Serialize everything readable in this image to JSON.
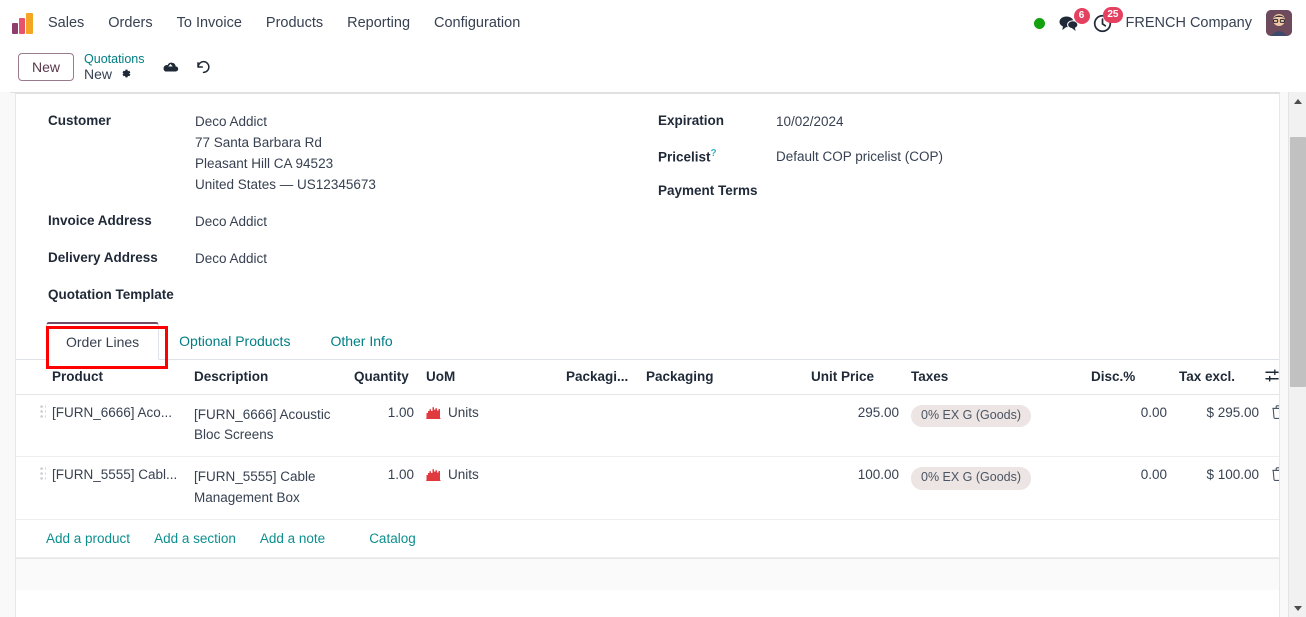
{
  "navbar": {
    "brand_icon": "odoo-sales-logo-icon",
    "menus": [
      {
        "label": "Sales",
        "name": "nav-sales"
      },
      {
        "label": "Orders",
        "name": "nav-orders"
      },
      {
        "label": "To Invoice",
        "name": "nav-to-invoice"
      },
      {
        "label": "Products",
        "name": "nav-products"
      },
      {
        "label": "Reporting",
        "name": "nav-reporting"
      },
      {
        "label": "Configuration",
        "name": "nav-configuration"
      }
    ],
    "status_dot_color": "#13a10e",
    "messages_count": "6",
    "activities_count": "25",
    "company": "FRENCH Company",
    "avatar_glyph": "👤"
  },
  "control_panel": {
    "new_button": "New",
    "breadcrumb_parent": "Quotations",
    "breadcrumb_current": "New",
    "gear_glyph": "⚙",
    "save_glyph": "☁",
    "discard_glyph": "↺"
  },
  "form": {
    "left": [
      {
        "label": "Customer",
        "name": "field-customer",
        "value": "Deco Addict",
        "extra_lines": [
          "77 Santa Barbara Rd",
          "Pleasant Hill CA 94523",
          "United States — US12345673"
        ]
      },
      {
        "label": "Invoice Address",
        "name": "field-invoice-address",
        "value": "Deco Addict",
        "extra_lines": []
      },
      {
        "label": "Delivery Address",
        "name": "field-delivery-address",
        "value": "Deco Addict",
        "extra_lines": []
      },
      {
        "label": "Quotation Template",
        "name": "field-quotation-template",
        "value": "",
        "extra_lines": []
      }
    ],
    "right": [
      {
        "label": "Expiration",
        "name": "field-expiration",
        "value": "10/02/2024",
        "help": false
      },
      {
        "label": "Pricelist",
        "name": "field-pricelist",
        "value": "Default COP pricelist (COP)",
        "help": true
      },
      {
        "label": "Payment Terms",
        "name": "field-payment-terms",
        "value": "",
        "help": false
      }
    ]
  },
  "notebook": {
    "tabs": [
      {
        "label": "Order Lines",
        "name": "tab-order-lines",
        "active": true,
        "highlighted": true
      },
      {
        "label": "Optional Products",
        "name": "tab-optional-products",
        "active": false,
        "highlighted": false
      },
      {
        "label": "Other Info",
        "name": "tab-other-info",
        "active": false,
        "highlighted": false
      }
    ],
    "highlight_color": "#ff0000"
  },
  "order_lines": {
    "headers": {
      "product": "Product",
      "description": "Description",
      "quantity": "Quantity",
      "uom": "UoM",
      "packaging_qty": "Packagi...",
      "packaging": "Packaging",
      "unit_price": "Unit Price",
      "taxes": "Taxes",
      "discount": "Disc.%",
      "tax_excl": "Tax excl.",
      "options_icon": "column-options-icon"
    },
    "rows": [
      {
        "handle_icon": "drag-handle-icon",
        "product": "[FURN_6666] Aco...",
        "description": "[FURN_6666] Acoustic Bloc Screens",
        "quantity": "1.00",
        "uom_icon": "uom-area-chart-icon",
        "uom": "Units",
        "packaging_qty": "",
        "packaging": "",
        "unit_price": "295.00",
        "taxes": "0% EX G (Goods)",
        "discount": "0.00",
        "tax_excl": "$ 295.00",
        "delete_icon": "trash-icon"
      },
      {
        "handle_icon": "drag-handle-icon",
        "product": "[FURN_5555] Cabl...",
        "description": "[FURN_5555] Cable Management Box",
        "quantity": "1.00",
        "uom_icon": "uom-area-chart-icon",
        "uom": "Units",
        "packaging_qty": "",
        "packaging": "",
        "unit_price": "100.00",
        "taxes": "0% EX G (Goods)",
        "discount": "0.00",
        "tax_excl": "$ 100.00",
        "delete_icon": "trash-icon"
      }
    ],
    "actions": [
      {
        "label": "Add a product",
        "name": "add-a-product-link"
      },
      {
        "label": "Add a section",
        "name": "add-a-section-link"
      },
      {
        "label": "Add a note",
        "name": "add-a-note-link"
      },
      {
        "label": "Catalog",
        "name": "catalog-link"
      }
    ]
  },
  "colors": {
    "accent": "#714b67",
    "link": "#017e84",
    "badge_red": "#e4405f",
    "tax_badge_bg": "#ece5e3"
  }
}
